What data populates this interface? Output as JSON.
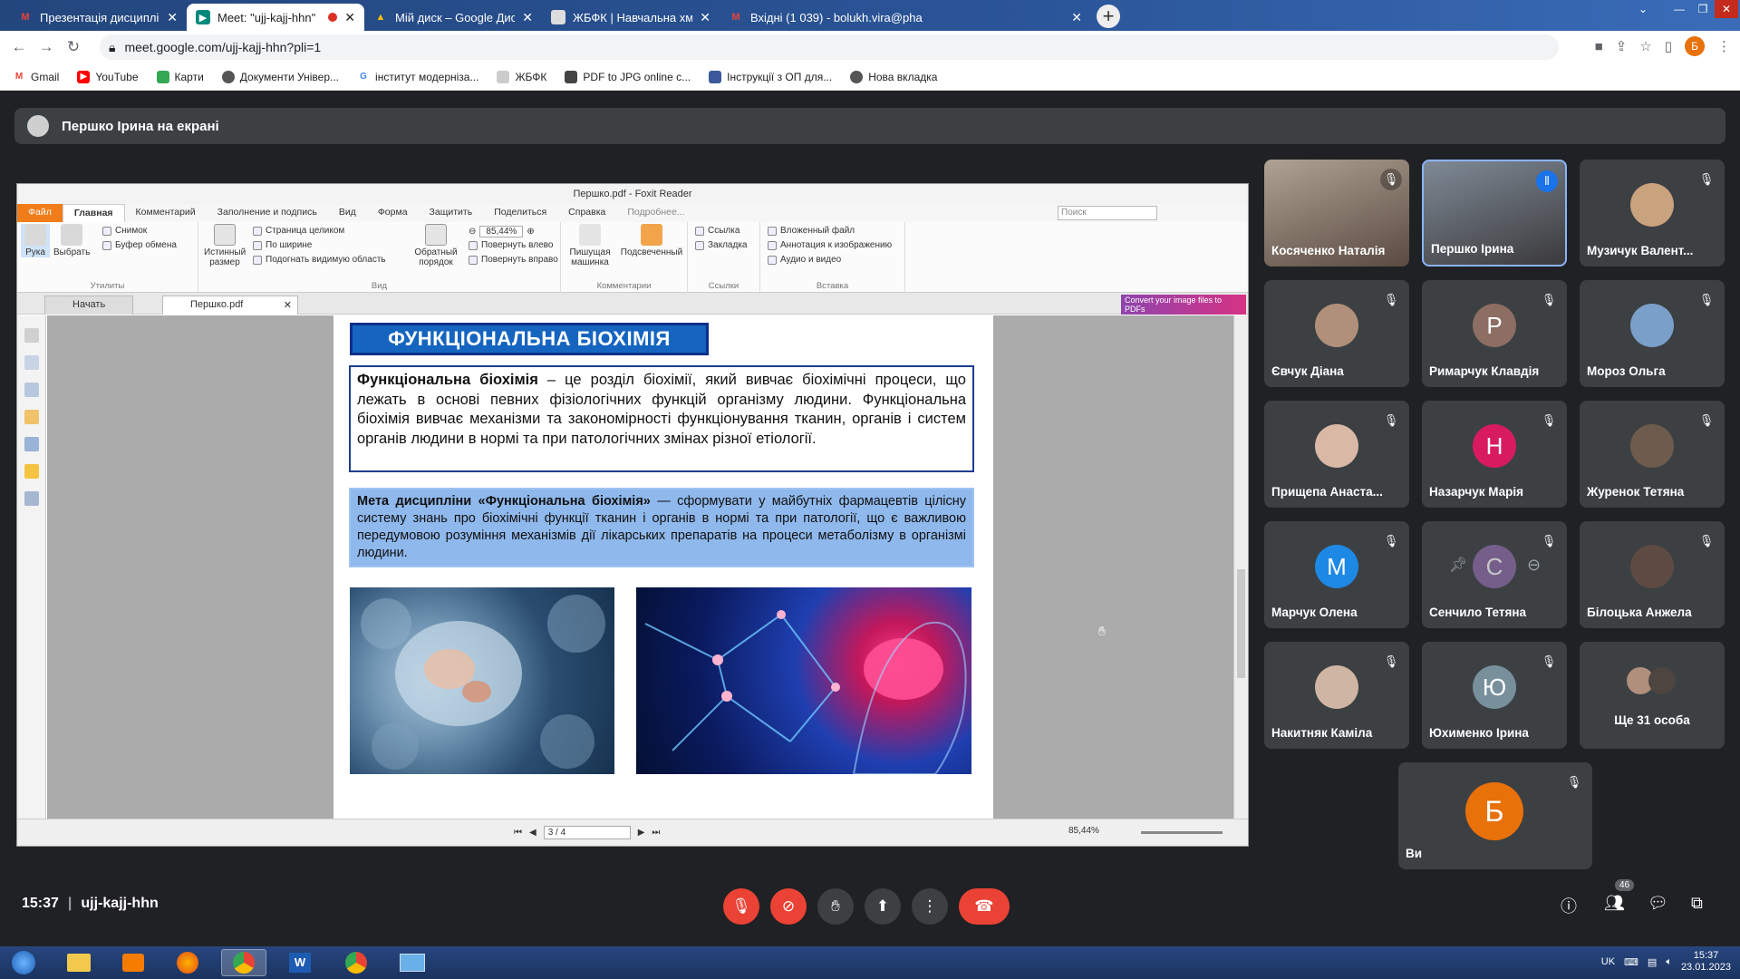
{
  "browser": {
    "tabs": [
      {
        "title": "Презентація дисциплін за вибо",
        "icon": "gmail-icon"
      },
      {
        "title": "Meet: \"ujj-kajj-hhn\"",
        "icon": "meet-icon"
      },
      {
        "title": "Мій диск – Google Диск",
        "icon": "drive-icon"
      },
      {
        "title": "ЖБФК | Навчальна хмара",
        "icon": "page-icon"
      },
      {
        "title": "Вхідні (1 039) - bolukh.vira@pha",
        "icon": "gmail-icon"
      }
    ],
    "url": "meet.google.com/ujj-kajj-hhn?pli=1",
    "profile_letter": "Б",
    "bookmarks": [
      "Gmail",
      "YouTube",
      "Карти",
      "Документи Універ...",
      "інститут модернізa...",
      "ЖБФК",
      "PDF to JPG online c...",
      "Інструкції з ОП для...",
      "Нова вкладка"
    ]
  },
  "meet": {
    "presenting_label": "Першко Ірина на екрані",
    "time": "15:37",
    "meeting_code": "ujj-kajj-hhn",
    "participants_count": "46",
    "participants": [
      {
        "name": "Косяченко Наталія",
        "letter": "",
        "color": "",
        "video": true
      },
      {
        "name": "Першко Ірина",
        "letter": "",
        "color": "",
        "video": true
      },
      {
        "name": "Музичук Валент...",
        "letter": "",
        "color": "#c9a27e",
        "video": false
      },
      {
        "name": "Євчук Діана",
        "letter": "",
        "color": "#b0907a",
        "video": false
      },
      {
        "name": "Римарчук Клавдія",
        "letter": "Р",
        "color": "#8d6e63",
        "video": false
      },
      {
        "name": "Мороз Ольга",
        "letter": "",
        "color": "#7aa0c9",
        "video": false
      },
      {
        "name": "Прищепа Анаста...",
        "letter": "",
        "color": "#d9b8a6",
        "video": false
      },
      {
        "name": "Назарчук Марія",
        "letter": "Н",
        "color": "#d81b60",
        "video": false
      },
      {
        "name": "Журенок Тетяна",
        "letter": "",
        "color": "#6d5c4e",
        "video": false
      },
      {
        "name": "Марчук Олена",
        "letter": "М",
        "color": "#1e88e5",
        "video": false
      },
      {
        "name": "Сенчило Тетяна",
        "letter": "С",
        "color": "#8e6ba8",
        "video": false
      },
      {
        "name": "Білоцька Анжела",
        "letter": "",
        "color": "#5d4a42",
        "video": false
      },
      {
        "name": "Накитняк Каміла",
        "letter": "",
        "color": "#cfb5a4",
        "video": false
      },
      {
        "name": "Юхименко Ірина",
        "letter": "Ю",
        "color": "#78909c",
        "video": false
      },
      {
        "name": "Ще 31 особа",
        "letter": "",
        "color": "",
        "video": false
      }
    ],
    "self": {
      "name": "Ви",
      "letter": "Б",
      "color": "#e8710a"
    }
  },
  "foxit": {
    "window_title": "Першко.pdf - Foxit Reader",
    "menu": [
      "Файл",
      "Главная",
      "Комментарий",
      "Заполнение и подпись",
      "Вид",
      "Форма",
      "Защитить",
      "Поделиться",
      "Справка",
      "Подробнее..."
    ],
    "search_placeholder": "Поиск",
    "ribbon": {
      "hand": "Рука",
      "select": "Выбрать",
      "snapshot": "Снимок",
      "clipboard": "Буфер обмена",
      "actual_size": "Истинный размер",
      "full_page": "Страница целиком",
      "fit_width": "По ширине",
      "fit_visible": "Подогнать видимую область",
      "reverse": "Обратный порядок",
      "zoom": "85,44%",
      "rotate_left": "Повернуть влево",
      "rotate_right": "Повернуть вправо",
      "typewriter": "Пишущая машинка",
      "highlight": "Подсвеченный",
      "link": "Ссылка",
      "bookmark": "Закладка",
      "embedded": "Вложенный файл",
      "image_annot": "Аннотация к изображению",
      "audio_video": "Аудио и видео",
      "groups": [
        "Утилиты",
        "Вид",
        "Комментарии",
        "Ссылки",
        "Вставка"
      ]
    },
    "doc_tabs": [
      "Начать",
      "Першко.pdf"
    ],
    "promo": "Convert your image files to PDFs",
    "page_counter": "3 / 4",
    "status_zoom": "85,44%"
  },
  "slide": {
    "title": "ФУНКЦІОНАЛЬНА БІОХІМІЯ",
    "def_term": "Функціональна біохімія",
    "def_text": " – це розділ біохімії, який вивчає біохімічні процеси, що лежать в основі певних фізіологічних функцій організму людини. Функціональна біохімія вивчає механізми та закономірності функціонування тканин, органів і систем органів людини в нормі та при патологічних змінах різної етіології.",
    "goal_term": "Мета дисципліни «Функціональна біохімія»",
    "goal_text": " — сформувати у майбутніх фармацевтів цілісну систему знань про біохімічні функції тканин і органів в нормі та при патології, що є важливою передумовою розуміння механізмів дії лікарських препаратів на процеси метаболізму в організмі людини."
  },
  "taskbar": {
    "lang": "UK",
    "time": "15:37",
    "date": "23.01.2023"
  }
}
